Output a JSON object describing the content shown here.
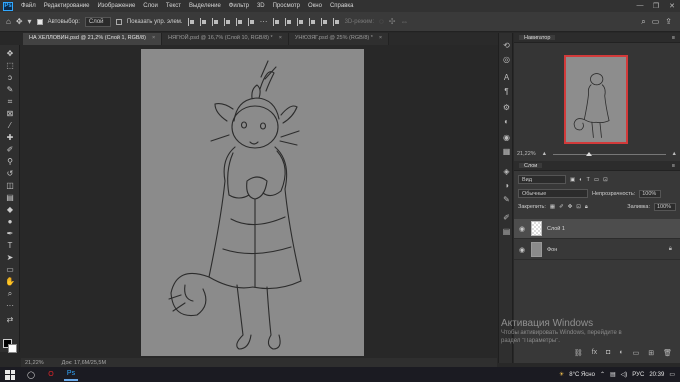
{
  "menubar": {
    "items": [
      "Файл",
      "Редактирование",
      "Изображение",
      "Слои",
      "Текст",
      "Выделение",
      "Фильтр",
      "3D",
      "Просмотр",
      "Окно",
      "Справка"
    ],
    "win_controls": [
      "—",
      "❐",
      "✕"
    ]
  },
  "options": {
    "autoselect_label": "Автовыбор:",
    "autoselect_value": "Слой",
    "show_controls_label": "Показать упр. элем.",
    "mode_3d_label": "3D-режим:"
  },
  "tabs": [
    {
      "label": "НА ХЕЛЛОВИН.psd @ 21,2% (Слой 1, RGB/8)",
      "close": "×",
      "active": true
    },
    {
      "label": "НЯГЮЙ.psd @ 16,7% (Слой 10, RGB/8) *",
      "close": "×",
      "active": false
    },
    {
      "label": "УНЮЗЯГ.psd @ 25% (RGB/8) *",
      "close": "×",
      "active": false
    }
  ],
  "statusbar": {
    "zoom": "21,22%",
    "doc_info": "Док: 17,6M/25,5M"
  },
  "navigator": {
    "title": "Навигатор",
    "zoom": "21,22%",
    "zoom_fraction": 0.29
  },
  "layers_panel": {
    "title": "Слои",
    "filter_label": "Вид",
    "blend_mode": "Обычные",
    "opacity_label": "Непрозрачность:",
    "opacity_value": "100%",
    "lock_label": "Закрепить:",
    "fill_label": "Заливка:",
    "fill_value": "100%",
    "layers": [
      {
        "name": "Слой 1",
        "active": true,
        "thumb": "transparent"
      },
      {
        "name": "Фон",
        "active": false,
        "thumb": "gray",
        "locked": true
      }
    ]
  },
  "watermark": {
    "title": "Активация Windows",
    "line1": "Чтобы активировать Windows, перейдите в",
    "line2": "раздел \"Параметры\"."
  },
  "taskbar": {
    "weather": "8°C Ясно",
    "lang": "РУС",
    "time": "20:39"
  },
  "colors": {
    "accent": "#31a8ff",
    "nav_frame": "#d23a3a",
    "canvas": "#8b8b8b"
  }
}
